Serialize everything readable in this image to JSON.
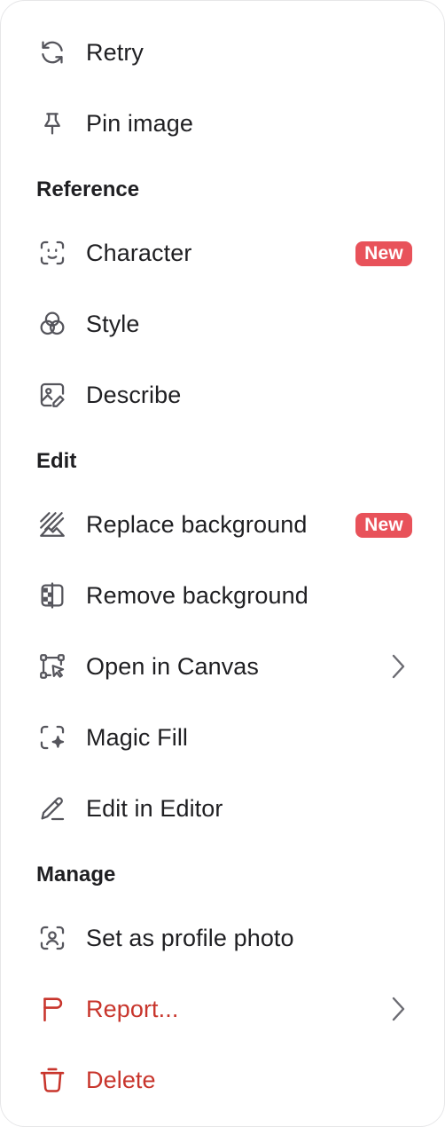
{
  "menu": {
    "items": {
      "retry": {
        "label": "Retry",
        "icon": "refresh-icon"
      },
      "pin": {
        "label": "Pin image",
        "icon": "pin-icon"
      },
      "character": {
        "label": "Character",
        "icon": "face-scan-icon",
        "badge": "New"
      },
      "style": {
        "label": "Style",
        "icon": "style-circles-icon"
      },
      "describe": {
        "label": "Describe",
        "icon": "image-edit-icon"
      },
      "replace_bg": {
        "label": "Replace background",
        "icon": "replace-background-icon",
        "badge": "New"
      },
      "remove_bg": {
        "label": "Remove background",
        "icon": "remove-background-icon"
      },
      "open_canvas": {
        "label": "Open in Canvas",
        "icon": "canvas-icon",
        "has_submenu": true
      },
      "magic_fill": {
        "label": "Magic Fill",
        "icon": "magic-fill-icon"
      },
      "edit_editor": {
        "label": "Edit in Editor",
        "icon": "pencil-icon"
      },
      "profile_photo": {
        "label": "Set as profile photo",
        "icon": "profile-scan-icon"
      },
      "report": {
        "label": "Report...",
        "icon": "flag-icon",
        "has_submenu": true
      },
      "delete": {
        "label": "Delete",
        "icon": "trash-icon"
      }
    },
    "sections": {
      "reference": "Reference",
      "edit": "Edit",
      "manage": "Manage"
    }
  },
  "colors": {
    "text": "#1f1f22",
    "icon": "#55555c",
    "danger": "#c8352c",
    "badge_bg": "#e8525a",
    "badge_text": "#ffffff",
    "chevron": "#6b6b72"
  }
}
